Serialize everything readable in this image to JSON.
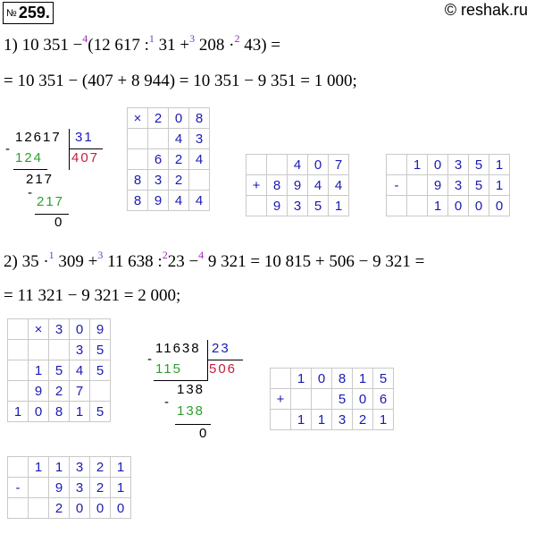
{
  "header": {
    "number_sign": "№",
    "number": "259.",
    "site": "© reshak.ru"
  },
  "task1": {
    "label": "1)",
    "expr": {
      "a": "10 351 −",
      "o4": "4",
      "p1": "(12 617 :",
      "o1": "1",
      "p2": "31 +",
      "o3": "3",
      "p3": "208 ·",
      "o2": "2",
      "p4": "43)",
      "eq": "="
    },
    "line2": "= 10 351 − (407 + 8 944) = 10 351 − 9 351 = 1 000;"
  },
  "task2": {
    "label": "2)",
    "expr": {
      "a": "35 ·",
      "o1": "1",
      "b": "309 +",
      "o3": "3",
      "c": "11 638 :",
      "o2": "2",
      "d": "23 −",
      "o4": "4",
      "e": "9 321 = 10 815 + 506 − 9 321 ="
    },
    "line2": "= 11 321 − 9 321 = 2 000;"
  },
  "div1": {
    "minus": "-",
    "dividend": "12617",
    "divisor": "31",
    "sub1": "124",
    "quotient": "407",
    "rem1": "217",
    "minus2": "-",
    "sub2": "217",
    "rem": "0"
  },
  "div2": {
    "minus": "-",
    "dividend": "11638",
    "divisor": "23",
    "sub1": "115",
    "quotient": "506",
    "rem1": "138",
    "minus2": "-",
    "sub2": "138",
    "rem": "0"
  },
  "mult1": [
    [
      "×",
      "2",
      "0",
      "8"
    ],
    [
      "",
      "",
      "4",
      "3"
    ],
    [
      "",
      "6",
      "2",
      "4"
    ],
    [
      "8",
      "3",
      "2",
      ""
    ],
    [
      "8",
      "9",
      "4",
      "4"
    ]
  ],
  "add1": [
    [
      "",
      "",
      "4",
      "0",
      "7"
    ],
    [
      "+",
      "8",
      "9",
      "4",
      "4"
    ],
    [
      "",
      "9",
      "3",
      "5",
      "1"
    ]
  ],
  "sub1": [
    [
      "",
      "1",
      "0",
      "3",
      "5",
      "1"
    ],
    [
      "-",
      "",
      "9",
      "3",
      "5",
      "1"
    ],
    [
      "",
      "",
      "1",
      "0",
      "0",
      "0"
    ]
  ],
  "mult2": [
    [
      "",
      "×",
      "3",
      "0",
      "9"
    ],
    [
      "",
      "",
      "",
      "3",
      "5"
    ],
    [
      "",
      "1",
      "5",
      "4",
      "5"
    ],
    [
      "",
      "9",
      "2",
      "7",
      ""
    ],
    [
      "1",
      "0",
      "8",
      "1",
      "5"
    ]
  ],
  "add2": [
    [
      "",
      "1",
      "0",
      "8",
      "1",
      "5"
    ],
    [
      "+",
      "",
      "",
      "5",
      "0",
      "6"
    ],
    [
      "",
      "1",
      "1",
      "3",
      "2",
      "1"
    ]
  ],
  "sub2": [
    [
      "",
      "1",
      "1",
      "3",
      "2",
      "1"
    ],
    [
      "-",
      "",
      "9",
      "3",
      "2",
      "1"
    ],
    [
      "",
      "",
      "2",
      "0",
      "0",
      "0"
    ]
  ]
}
